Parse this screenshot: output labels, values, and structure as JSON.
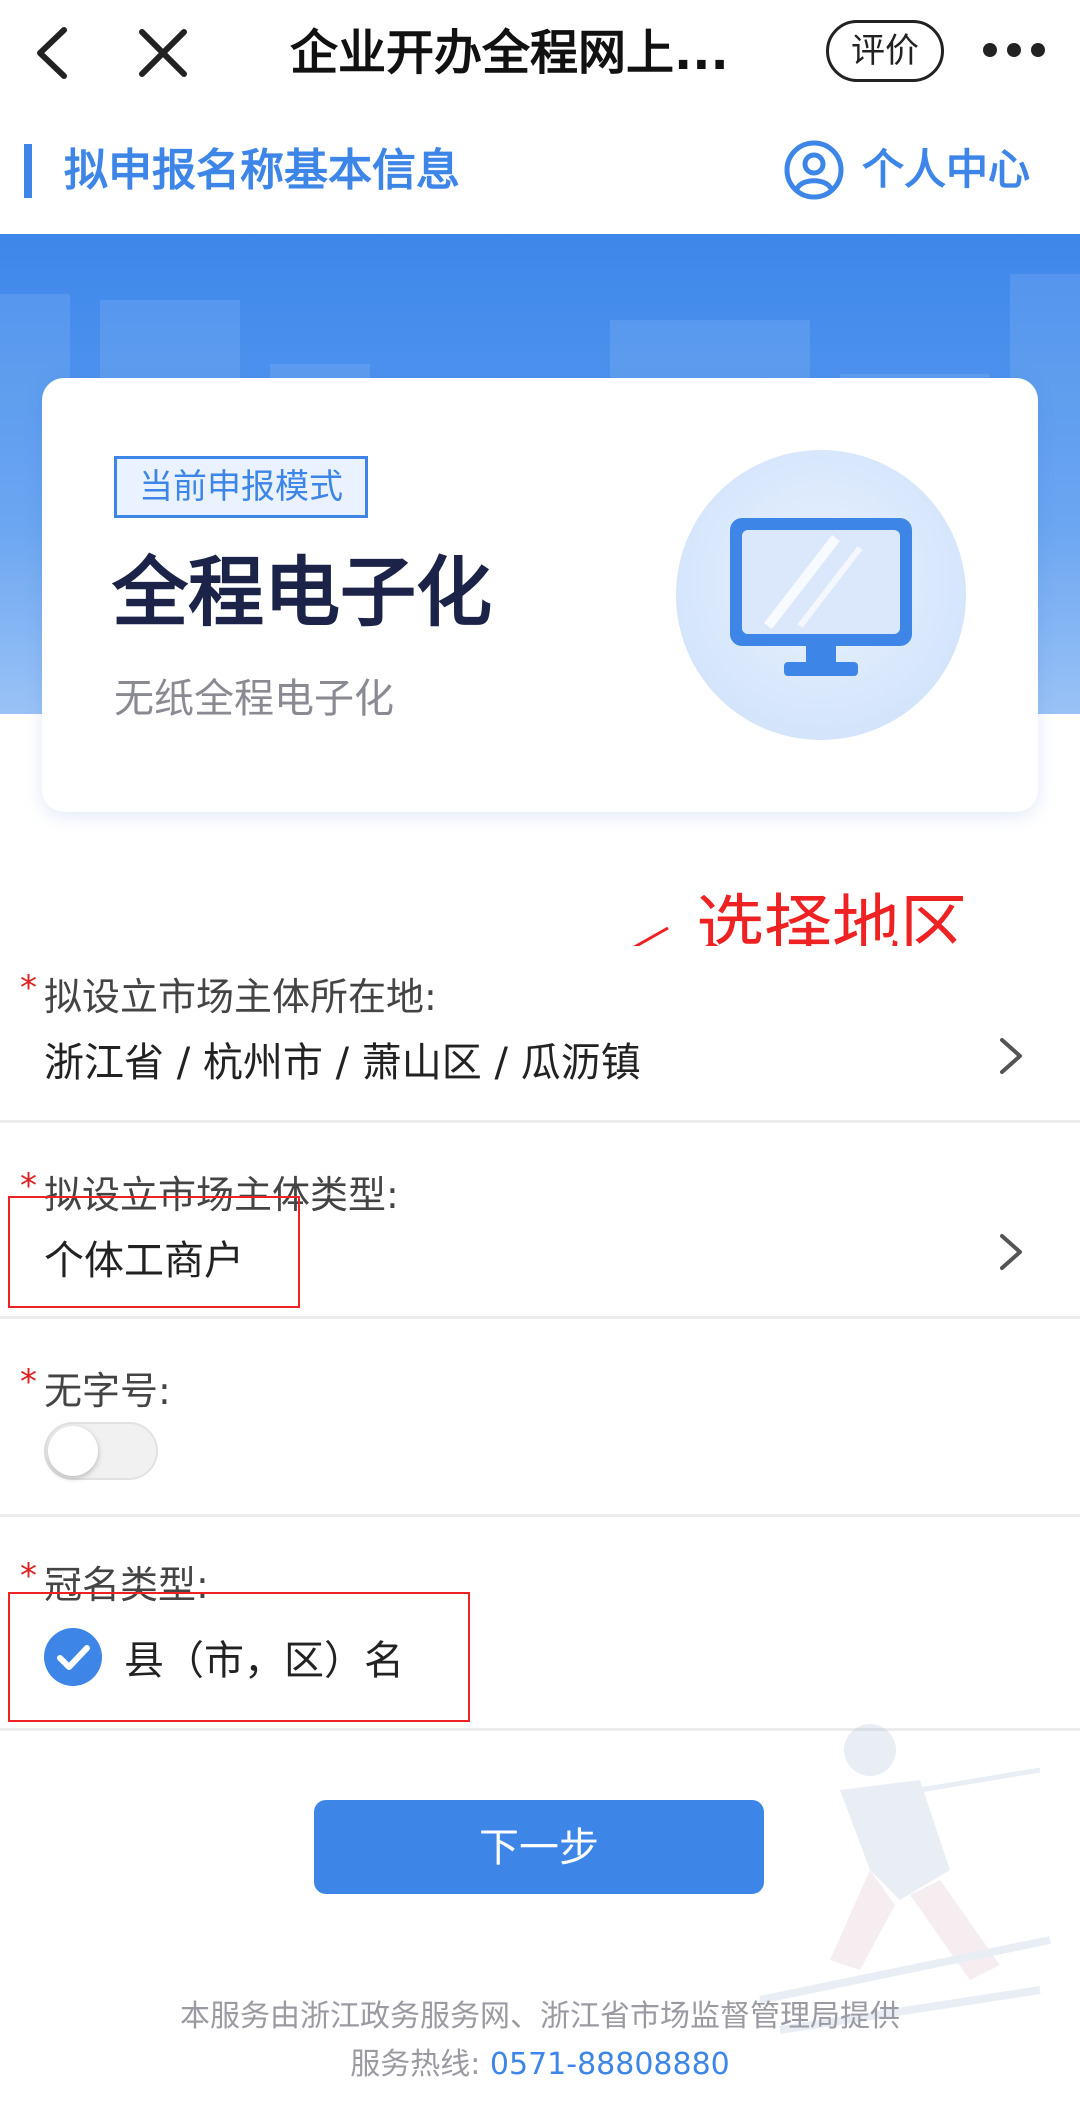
{
  "navbar": {
    "title": "企业开办全程网上...",
    "evaluate_label": "评价"
  },
  "section": {
    "title": "拟申报名称基本信息",
    "personal_center": "个人中心"
  },
  "mode_card": {
    "tag": "当前申报模式",
    "title": "全程电子化",
    "subtitle": "无纸全程电子化"
  },
  "annotation": {
    "text": "选择地区"
  },
  "form": {
    "location": {
      "label": "拟设立市场主体所在地:",
      "value": "浙江省 / 杭州市 / 萧山区 / 瓜沥镇"
    },
    "entity_type": {
      "label": "拟设立市场主体类型:",
      "value": "个体工商户"
    },
    "no_trade_name": {
      "label": "无字号:",
      "enabled": false
    },
    "crown_type": {
      "label": "冠名类型:",
      "option": "县（市，区）名",
      "checked": true
    },
    "required_mark": "*"
  },
  "next_button": "下一步",
  "footer": {
    "provider": "本服务由浙江政务服务网、浙江省市场监督管理局提供",
    "hotline_label": "服务热线:",
    "hotline_number": "0571-88808880"
  },
  "colors": {
    "accent": "#3d86e8",
    "annotation": "#ee2222",
    "title_dark": "#1b2348"
  }
}
